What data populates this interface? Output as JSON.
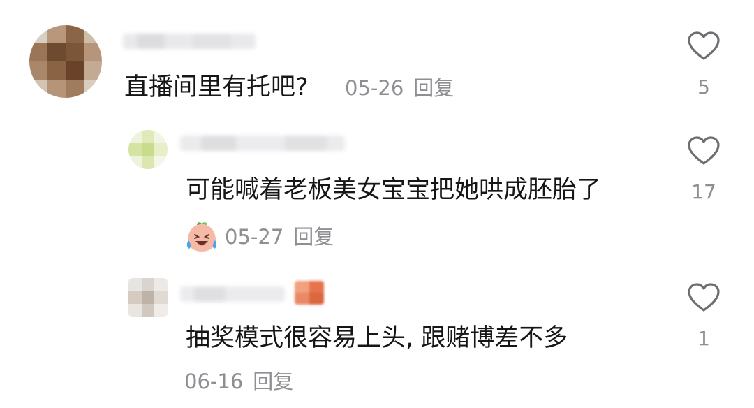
{
  "comments": [
    {
      "text": "直播间里有托吧?",
      "date": "05-26",
      "reply_label": "回复",
      "likes": "5",
      "avatar_icon": "pixelated-avatar-icon"
    },
    {
      "text": "可能喊着老板美女宝宝把她哄成胚胎了",
      "date": "05-27",
      "reply_label": "回复",
      "likes": "17",
      "emoji_icon": "crying-laughing-peach-emoji-icon",
      "avatar_icon": "pixelated-avatar-icon"
    },
    {
      "text": "抽奖模式很容易上头, 跟赌博差不多",
      "date": "06-16",
      "reply_label": "回复",
      "likes": "1",
      "avatar_icon": "pixelated-avatar-icon"
    }
  ],
  "colors": {
    "text": "#161616",
    "meta": "#8e8e93",
    "heart": "#6d6d72"
  }
}
